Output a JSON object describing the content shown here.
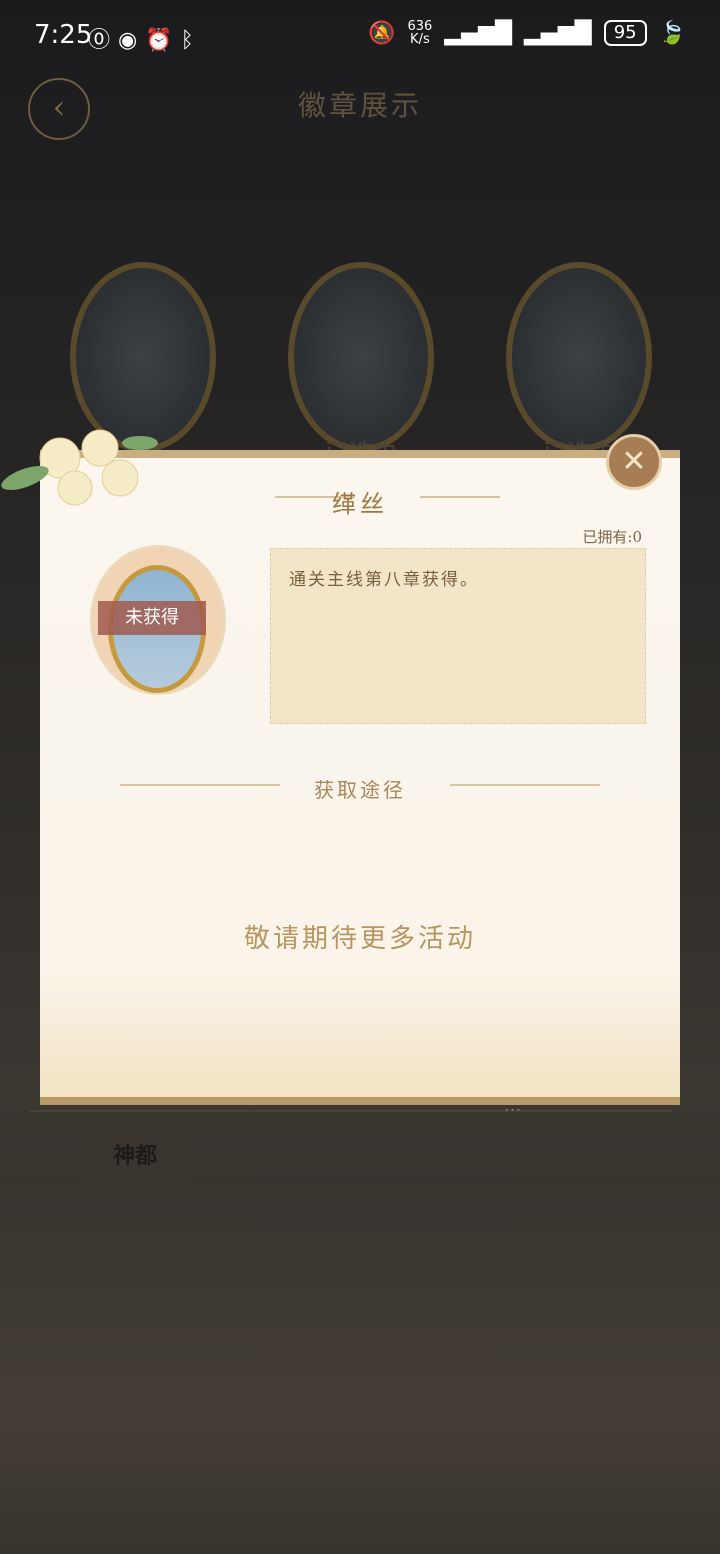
{
  "status_bar": {
    "time": "7:25",
    "icons": [
      "hd-icon",
      "hotspot-icon",
      "alarm-icon",
      "bluetooth-icon"
    ],
    "net_speed_value": "636",
    "net_speed_unit": "K/s",
    "battery": "95"
  },
  "background": {
    "title": "徽章展示",
    "badge_labels": [
      "中",
      "已选中",
      "已选中"
    ],
    "city_label": "神都"
  },
  "modal": {
    "title": "缂丝",
    "owned": "已拥有:0",
    "badge_status": "未获得",
    "description": "通关主线第八章获得。",
    "section_title": "获取途径",
    "empty_text": "敬请期待更多活动"
  }
}
